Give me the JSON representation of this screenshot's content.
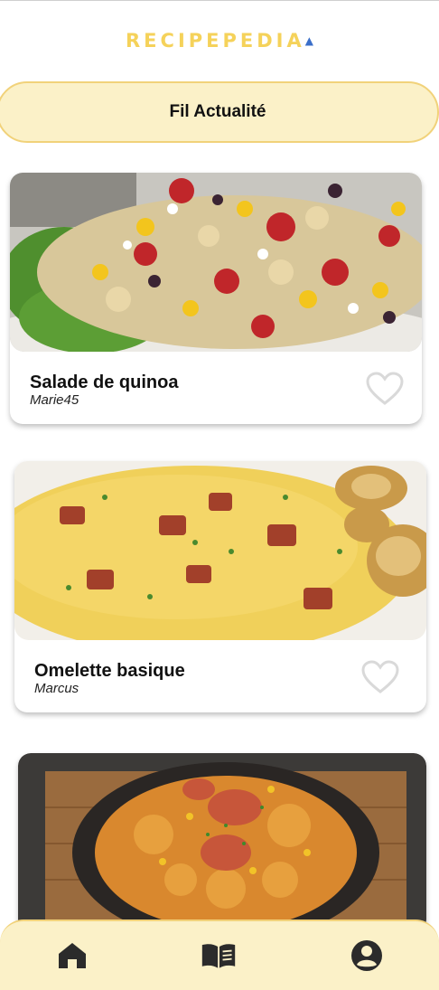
{
  "colors": {
    "brand_yellow": "#f5d25a",
    "tab_background": "#fbf1c8",
    "heart_outline": "#d9d9d9"
  },
  "header": {
    "logo_text": "RECIPEPEDIA",
    "logo_icon": "chef-hat-icon"
  },
  "feed_tab": {
    "label": "Fil Actualité"
  },
  "recipes": [
    {
      "title": "Salade de quinoa",
      "author": "Marie45",
      "image": "quinoa-salad-photo",
      "favorite": false
    },
    {
      "title": "Omelette basique",
      "author": "Marcus",
      "image": "omelette-photo",
      "favorite": false
    },
    {
      "title": "",
      "author": "",
      "image": "pasta-photo",
      "favorite": false
    }
  ],
  "bottom_nav": {
    "items": [
      {
        "icon": "home-icon"
      },
      {
        "icon": "book-icon"
      },
      {
        "icon": "account-icon"
      }
    ]
  }
}
